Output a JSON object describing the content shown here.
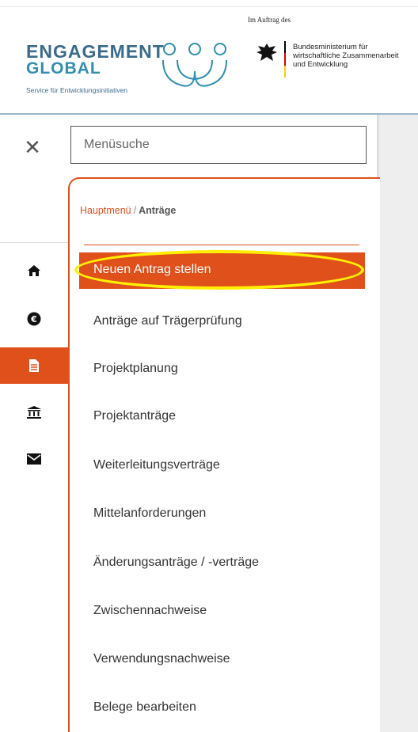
{
  "header": {
    "logo_line1": "ENGAGEMENT",
    "logo_line2": "GLOBAL",
    "logo_tagline": "Service für Entwicklungsinitiativen",
    "im_auftrag": "Im Auftrag des",
    "ministry_line1": "Bundesministerium für",
    "ministry_line2": "wirtschaftliche Zusammenarbeit",
    "ministry_line3": "und Entwicklung"
  },
  "search": {
    "placeholder": "Menüsuche"
  },
  "breadcrumb": {
    "root": "Hauptmenü",
    "separator": "/",
    "current": "Anträge"
  },
  "menu": {
    "active": "Neuen Antrag stellen",
    "items": [
      "Anträge auf Trägerprüfung",
      "Projektplanung",
      "Projektanträge",
      "Weiterleitungsverträge",
      "Mittelanforderungen",
      "Änderungsanträge / -verträge",
      "Zwischennachweise",
      "Verwendungsnachweise",
      "Belege bearbeiten"
    ]
  },
  "rail_icons": [
    "home-icon",
    "euro-icon",
    "document-icon",
    "institution-icon",
    "mail-icon"
  ],
  "colors": {
    "accent": "#e0501b",
    "highlight": "#ffef00",
    "brand_blue": "#3b6b8c"
  }
}
